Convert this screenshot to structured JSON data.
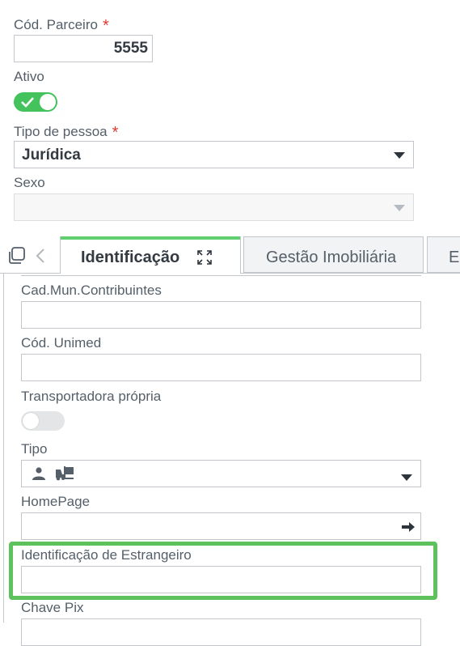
{
  "header_form": {
    "cod_parceiro": {
      "label": "Cód. Parceiro",
      "value": "5555"
    },
    "ativo": {
      "label": "Ativo",
      "state": "on"
    },
    "tipo_pessoa": {
      "label": "Tipo de pessoa",
      "value": "Jurídica"
    },
    "sexo": {
      "label": "Sexo",
      "value": ""
    }
  },
  "tabs": [
    {
      "label": "Identificação",
      "active": true
    },
    {
      "label": "Gestão Imobiliária",
      "active": false
    },
    {
      "label": "E",
      "active": false
    }
  ],
  "identificacao": {
    "cad_mun": {
      "label": "Cad.Mun.Contribuintes",
      "value": ""
    },
    "cod_unimed": {
      "label": "Cód. Unimed",
      "value": ""
    },
    "transportadora": {
      "label": "Transportadora própria",
      "state": "off"
    },
    "tipo": {
      "label": "Tipo",
      "icons": [
        "person-icon",
        "forklift-icon"
      ]
    },
    "homepage": {
      "label": "HomePage",
      "value": ""
    },
    "estrangeiro": {
      "label": "Identificação de Estrangeiro",
      "value": ""
    },
    "chave_pix": {
      "label": "Chave Pix"
    }
  },
  "colors": {
    "accent": "#44c25c",
    "required": "#e03a2f",
    "highlight": "#5dc15c"
  },
  "required_marker": "*"
}
